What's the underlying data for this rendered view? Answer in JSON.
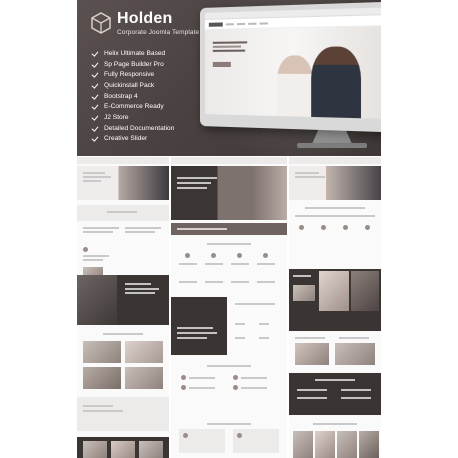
{
  "product": {
    "name": "Holden",
    "subtitle": "Corporate Joomla Template"
  },
  "features": [
    "Helix Ultimate Based",
    "Sp Page Builder Pro",
    "Fully Responsive",
    "Quickinstall Pack",
    "Bootstrap 4",
    "E-Commerce Ready",
    "J2 Store",
    "Detailed Documentation",
    "Creative Slider"
  ],
  "colors": {
    "hero_bg": "#4a4240",
    "dark_block": "#3a3433",
    "accent": "#6f6361",
    "text_light": "#ffffff"
  },
  "icons": {
    "logo": "hexagon-cube-logo",
    "feature_bullet": "check-icon"
  }
}
